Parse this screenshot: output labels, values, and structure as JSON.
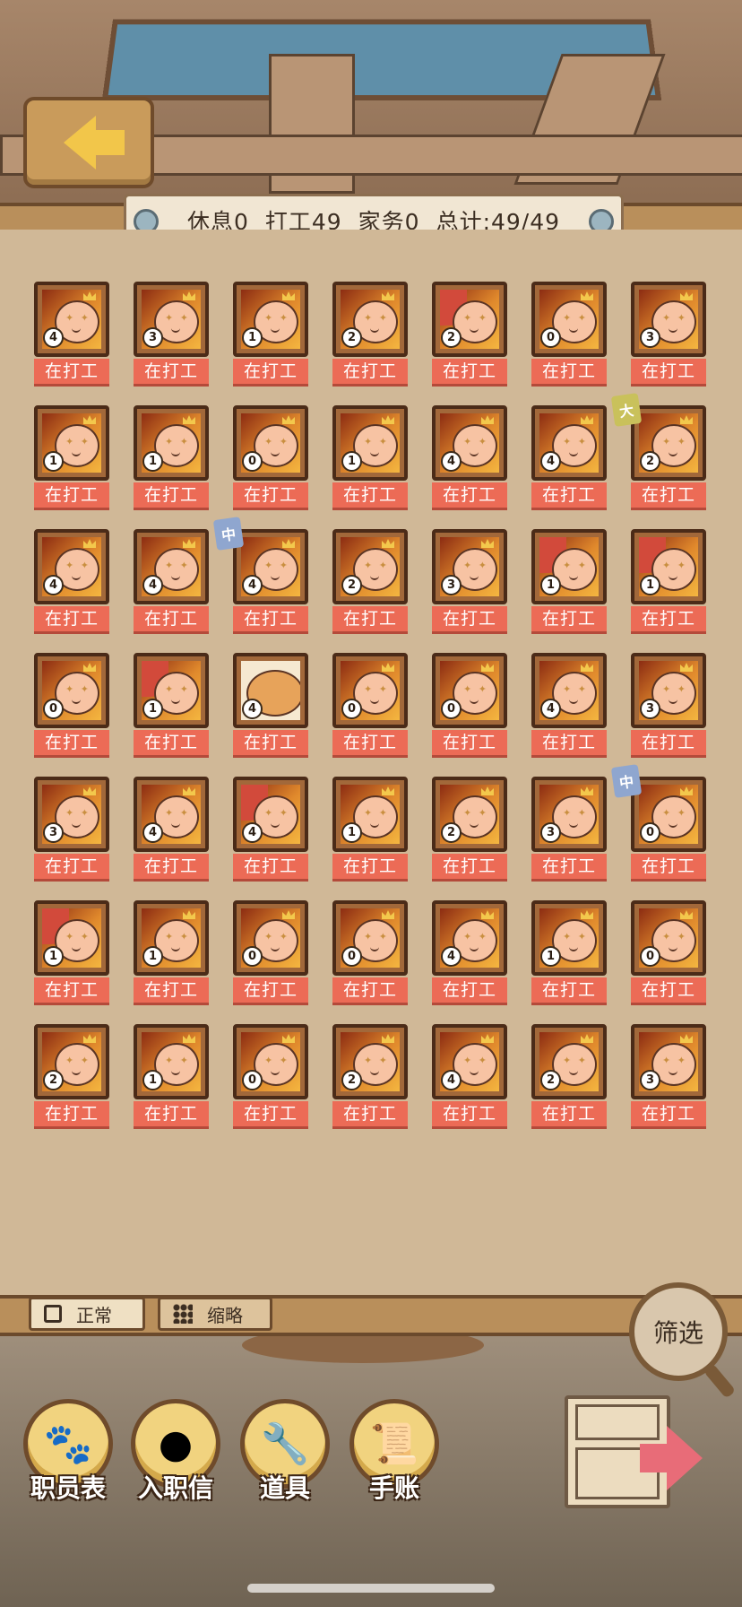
{
  "header": {
    "rest_label": "休息0",
    "work_label": "打工49",
    "chores_label": "家务0",
    "total_label": "总计:49/49"
  },
  "staff": [
    {
      "level": "4",
      "status": "在打工",
      "type": "a"
    },
    {
      "level": "3",
      "status": "在打工",
      "type": "a"
    },
    {
      "level": "1",
      "status": "在打工",
      "type": "a"
    },
    {
      "level": "2",
      "status": "在打工",
      "type": "a"
    },
    {
      "level": "2",
      "status": "在打工",
      "type": "b"
    },
    {
      "level": "0",
      "status": "在打工",
      "type": "a"
    },
    {
      "level": "3",
      "status": "在打工",
      "type": "a"
    },
    {
      "level": "1",
      "status": "在打工",
      "type": "a"
    },
    {
      "level": "1",
      "status": "在打工",
      "type": "a"
    },
    {
      "level": "0",
      "status": "在打工",
      "type": "a"
    },
    {
      "level": "1",
      "status": "在打工",
      "type": "a"
    },
    {
      "level": "4",
      "status": "在打工",
      "type": "a"
    },
    {
      "level": "4",
      "status": "在打工",
      "type": "a"
    },
    {
      "level": "2",
      "status": "在打工",
      "type": "a",
      "tag": "大",
      "tag_color": "yellow"
    },
    {
      "level": "4",
      "status": "在打工",
      "type": "a"
    },
    {
      "level": "4",
      "status": "在打工",
      "type": "a"
    },
    {
      "level": "4",
      "status": "在打工",
      "type": "a",
      "tag": "中",
      "tag_color": "blue"
    },
    {
      "level": "2",
      "status": "在打工",
      "type": "a"
    },
    {
      "level": "3",
      "status": "在打工",
      "type": "a"
    },
    {
      "level": "1",
      "status": "在打工",
      "type": "b"
    },
    {
      "level": "1",
      "status": "在打工",
      "type": "b"
    },
    {
      "level": "0",
      "status": "在打工",
      "type": "a"
    },
    {
      "level": "1",
      "status": "在打工",
      "type": "b"
    },
    {
      "level": "4",
      "status": "在打工",
      "type": "h"
    },
    {
      "level": "0",
      "status": "在打工",
      "type": "a"
    },
    {
      "level": "0",
      "status": "在打工",
      "type": "a"
    },
    {
      "level": "4",
      "status": "在打工",
      "type": "a"
    },
    {
      "level": "3",
      "status": "在打工",
      "type": "a"
    },
    {
      "level": "3",
      "status": "在打工",
      "type": "a"
    },
    {
      "level": "4",
      "status": "在打工",
      "type": "a"
    },
    {
      "level": "4",
      "status": "在打工",
      "type": "b"
    },
    {
      "level": "1",
      "status": "在打工",
      "type": "a"
    },
    {
      "level": "2",
      "status": "在打工",
      "type": "a"
    },
    {
      "level": "3",
      "status": "在打工",
      "type": "a"
    },
    {
      "level": "0",
      "status": "在打工",
      "type": "a",
      "tag": "中",
      "tag_color": "blue"
    },
    {
      "level": "1",
      "status": "在打工",
      "type": "b"
    },
    {
      "level": "1",
      "status": "在打工",
      "type": "a"
    },
    {
      "level": "0",
      "status": "在打工",
      "type": "a"
    },
    {
      "level": "0",
      "status": "在打工",
      "type": "a"
    },
    {
      "level": "4",
      "status": "在打工",
      "type": "a"
    },
    {
      "level": "1",
      "status": "在打工",
      "type": "a"
    },
    {
      "level": "0",
      "status": "在打工",
      "type": "a"
    },
    {
      "level": "2",
      "status": "在打工",
      "type": "a"
    },
    {
      "level": "1",
      "status": "在打工",
      "type": "a"
    },
    {
      "level": "0",
      "status": "在打工",
      "type": "a"
    },
    {
      "level": "2",
      "status": "在打工",
      "type": "a"
    },
    {
      "level": "4",
      "status": "在打工",
      "type": "a"
    },
    {
      "level": "2",
      "status": "在打工",
      "type": "a"
    },
    {
      "level": "3",
      "status": "在打工",
      "type": "a"
    }
  ],
  "view_toggle": {
    "normal_label": "正常",
    "compact_label": "缩略"
  },
  "filter_label": "筛选",
  "nav": [
    {
      "label": "职员表",
      "icon": "paw-icon"
    },
    {
      "label": "入职信",
      "icon": "coin-icon"
    },
    {
      "label": "道具",
      "icon": "wrench-icon"
    },
    {
      "label": "手账",
      "icon": "notebook-icon"
    }
  ]
}
